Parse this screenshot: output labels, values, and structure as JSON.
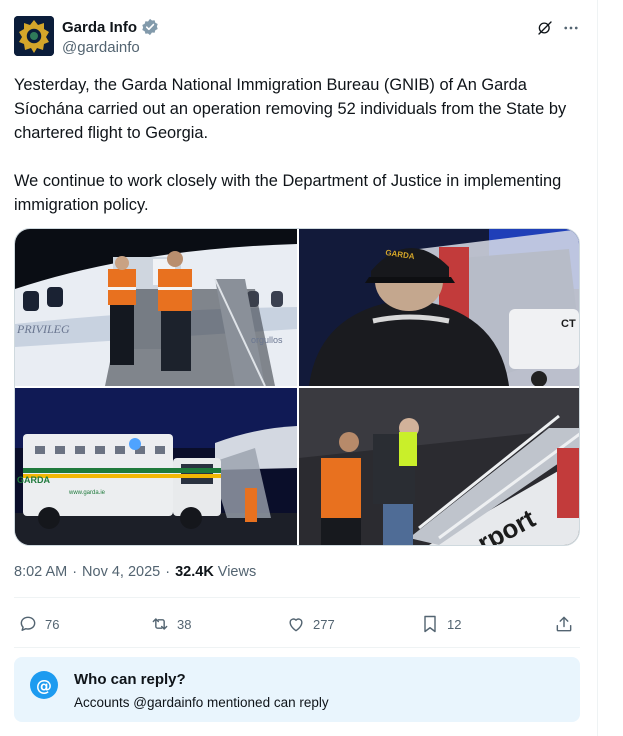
{
  "author": {
    "name": "Garda Info",
    "handle": "@gardainfo",
    "verified_icon": "verified-badge-icon",
    "avatar_icon": "garda-crest-logo"
  },
  "header_actions": {
    "grok_icon": "grok-icon",
    "more_icon": "more-icon"
  },
  "tweet": {
    "paragraphs": [
      "Yesterday, the Garda National Immigration Bureau (GNIB) of An Garda Síochána carried out an operation removing 52 individuals from the State by chartered flight to Georgia.",
      "We continue to work closely with the Department of Justice in implementing immigration policy."
    ]
  },
  "media": {
    "images": [
      {
        "label": "PRIVILEG",
        "label2": "orgullos"
      },
      {
        "label": "GARDA",
        "label2": "CT"
      },
      {
        "label": "GARDA",
        "label2": "www.garda.ie"
      },
      {
        "label": "rport",
        "label2": ""
      }
    ]
  },
  "meta": {
    "time": "8:02 AM",
    "separator": "·",
    "date": "Nov 4, 2025",
    "views_count": "32.4K",
    "views_label": "Views"
  },
  "actions": {
    "reply_count": "76",
    "repost_count": "38",
    "like_count": "277",
    "bookmark_count": "12"
  },
  "who_can_reply": {
    "icon_glyph": "@",
    "title": "Who can reply?",
    "subtitle": "Accounts @gardainfo mentioned can reply"
  },
  "colors": {
    "accent": "#1d9bf0",
    "text": "#0f1419",
    "muted": "#536471",
    "reply_box_bg": "#e9f5fd"
  }
}
